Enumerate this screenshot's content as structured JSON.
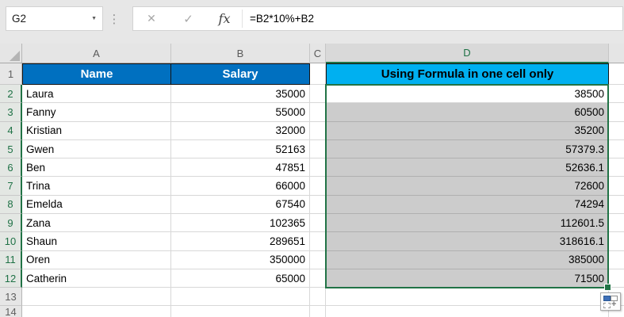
{
  "name_box": {
    "value": "G2"
  },
  "formula_bar": {
    "formula": "=B2*10%+B2",
    "icons": {
      "cancel": "✕",
      "enter": "✓",
      "fx": "fx",
      "dropdown": "▼",
      "more": "⋮",
      "plus": "+"
    }
  },
  "sheet": {
    "column_headers": [
      "A",
      "B",
      "C",
      "D"
    ],
    "header_row": {
      "row_number": "1",
      "name_header": "Name",
      "salary_header": "Salary",
      "formula_header": "Using Formula in one cell only"
    },
    "records": [
      {
        "row": "2",
        "name": "Laura",
        "salary": "35000",
        "result": "38500"
      },
      {
        "row": "3",
        "name": "Fanny",
        "salary": "55000",
        "result": "60500"
      },
      {
        "row": "4",
        "name": "Kristian",
        "salary": "32000",
        "result": "35200"
      },
      {
        "row": "5",
        "name": "Gwen",
        "salary": "52163",
        "result": "57379.3"
      },
      {
        "row": "6",
        "name": "Ben",
        "salary": "47851",
        "result": "52636.1"
      },
      {
        "row": "7",
        "name": "Trina",
        "salary": "66000",
        "result": "72600"
      },
      {
        "row": "8",
        "name": "Emelda",
        "salary": "67540",
        "result": "74294"
      },
      {
        "row": "9",
        "name": "Zana",
        "salary": "102365",
        "result": "112601.5"
      },
      {
        "row": "10",
        "name": "Shaun",
        "salary": "289651",
        "result": "318616.1"
      },
      {
        "row": "11",
        "name": "Oren",
        "salary": "350000",
        "result": "385000"
      },
      {
        "row": "12",
        "name": "Catherin",
        "salary": "65000",
        "result": "71500"
      }
    ],
    "trailing_rows": [
      "13",
      "14"
    ]
  },
  "colors": {
    "header_blue": "#0070C0",
    "header_cyan": "#00B0F0",
    "selection_green": "#217346",
    "selected_fill_gray": "#CCCCCC",
    "topbar_gray": "#E7E7E7"
  }
}
